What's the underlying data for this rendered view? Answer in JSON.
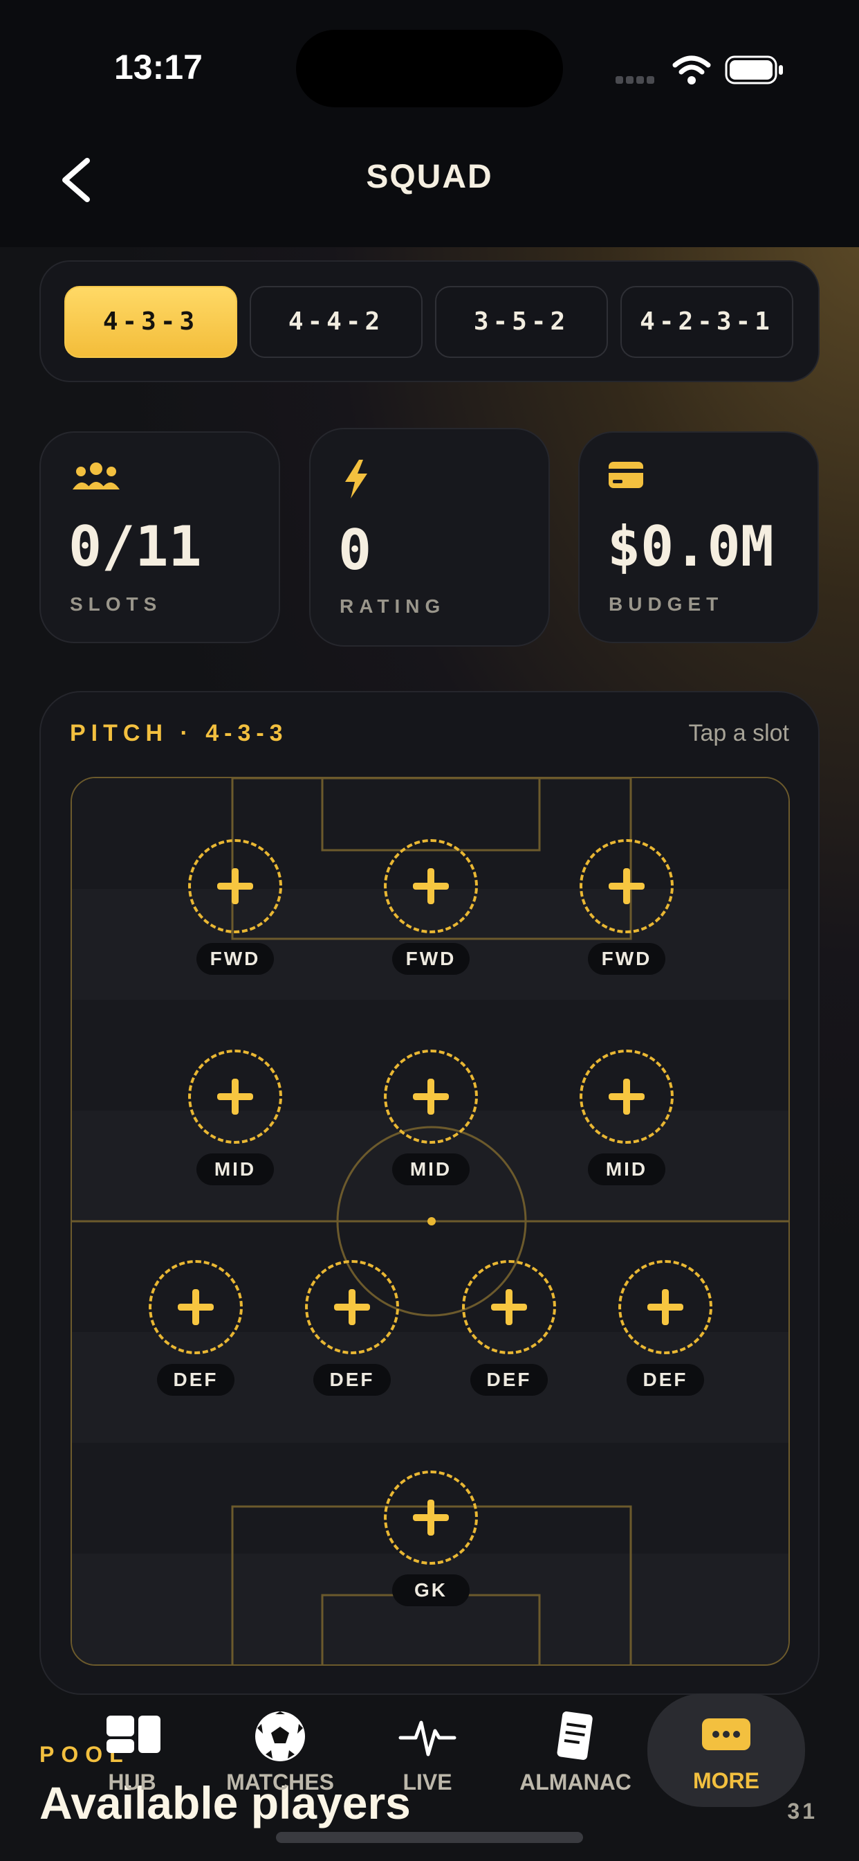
{
  "status": {
    "time": "13:17"
  },
  "header": {
    "title": "SQUAD"
  },
  "formations": [
    {
      "label": "4-3-3",
      "active": true
    },
    {
      "label": "4-4-2",
      "active": false
    },
    {
      "label": "3-5-2",
      "active": false
    },
    {
      "label": "4-2-3-1",
      "active": false
    }
  ],
  "stats": [
    {
      "value": "0/11",
      "label": "SLOTS",
      "icon": "users-icon"
    },
    {
      "value": "0",
      "label": "RATING",
      "icon": "bolt-icon"
    },
    {
      "value": "$0.0M",
      "label": "BUDGET",
      "icon": "card-icon"
    }
  ],
  "pitch": {
    "title": "PITCH · 4-3-3",
    "hint": "Tap a slot",
    "rows": [
      [
        "FWD",
        "FWD",
        "FWD"
      ],
      [
        "MID",
        "MID",
        "MID"
      ],
      [
        "DEF",
        "DEF",
        "DEF",
        "DEF"
      ],
      [
        "GK"
      ]
    ]
  },
  "pool": {
    "eyebrow": "POOL",
    "title": "Available players",
    "count": "31"
  },
  "tabs": [
    {
      "label": "HUB",
      "icon": "hub-icon",
      "active": false
    },
    {
      "label": "MATCHES",
      "icon": "soccer-ball-icon",
      "active": false
    },
    {
      "label": "LIVE",
      "icon": "pulse-icon",
      "active": false
    },
    {
      "label": "ALMANAC",
      "icon": "notebook-icon",
      "active": false
    },
    {
      "label": "MORE",
      "icon": "more-icon",
      "active": true
    }
  ],
  "colors": {
    "accent": "#f3c03f",
    "background": "#121316",
    "card": "#17181d"
  }
}
